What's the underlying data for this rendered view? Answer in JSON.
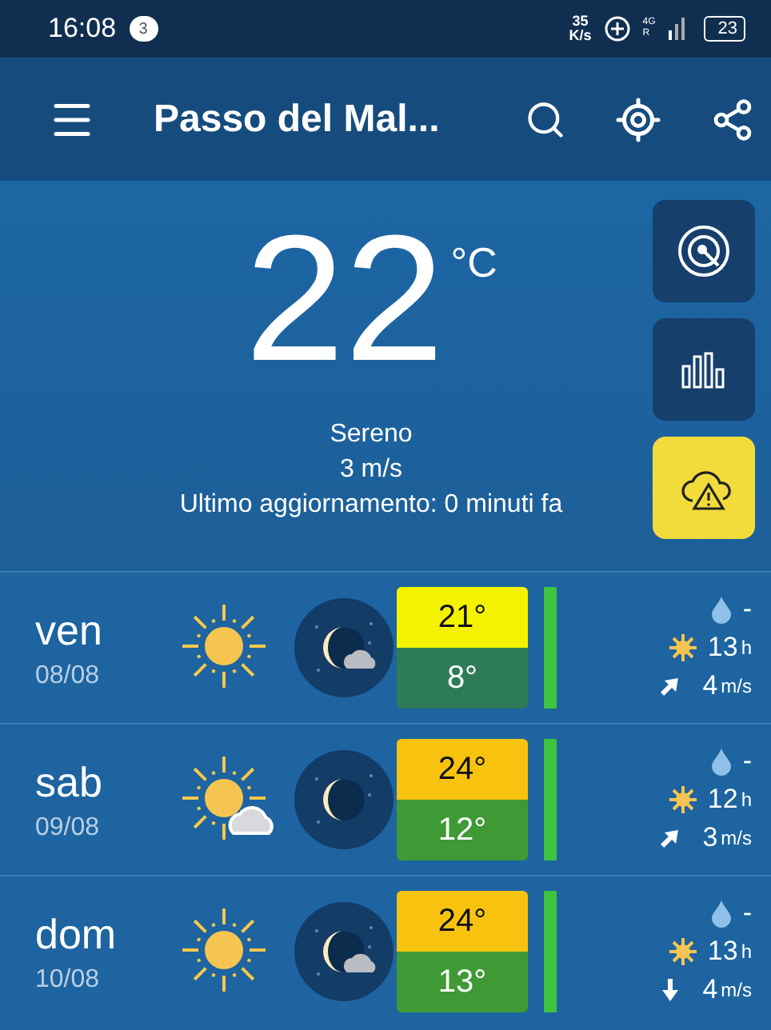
{
  "status_bar": {
    "time": "16:08",
    "notification_count": "3",
    "speed_value": "35",
    "speed_unit": "K/s",
    "network": "4G",
    "roaming": "R",
    "battery": "23"
  },
  "app_bar": {
    "title": "Passo del Mal..."
  },
  "current": {
    "temperature": "22",
    "unit": "°C",
    "condition": "Sereno",
    "wind": "3 m/s",
    "updated": "Ultimo aggiornamento: 0 minuti fa"
  },
  "side_buttons": [
    {
      "kind": "radar"
    },
    {
      "kind": "chart"
    },
    {
      "kind": "alert"
    }
  ],
  "days": [
    {
      "day": "ven",
      "date": "08/08",
      "day_icon": {
        "kind": "sun"
      },
      "night_icon": {
        "kind": "cloudy"
      },
      "max": {
        "value": "21°",
        "color": "#f5f200"
      },
      "min": {
        "value": "8°",
        "color": "#2e7b58"
      },
      "bar": {
        "color": "#3ec43f"
      },
      "rain": "-",
      "sun_hours": "13",
      "sun_unit": "h",
      "wind": {
        "value": "4",
        "unit": "m/s",
        "kind": "rising"
      }
    },
    {
      "day": "sab",
      "date": "09/08",
      "day_icon": {
        "kind": "cloudy"
      },
      "night_icon": {
        "kind": "clear"
      },
      "max": {
        "value": "24°",
        "color": "#f7c30e"
      },
      "min": {
        "value": "12°",
        "color": "#3f9a36"
      },
      "bar": {
        "color": "#3ec43f"
      },
      "rain": "-",
      "sun_hours": "12",
      "sun_unit": "h",
      "wind": {
        "value": "3",
        "unit": "m/s",
        "kind": "rising"
      }
    },
    {
      "day": "dom",
      "date": "10/08",
      "day_icon": {
        "kind": "sun"
      },
      "night_icon": {
        "kind": "cloudy"
      },
      "max": {
        "value": "24°",
        "color": "#f7c30e"
      },
      "min": {
        "value": "13°",
        "color": "#3f9a36"
      },
      "bar": {
        "color": "#3ec43f"
      },
      "rain": "-",
      "sun_hours": "13",
      "sun_unit": "h",
      "wind": {
        "value": "4",
        "unit": "m/s",
        "kind": "down"
      }
    }
  ]
}
